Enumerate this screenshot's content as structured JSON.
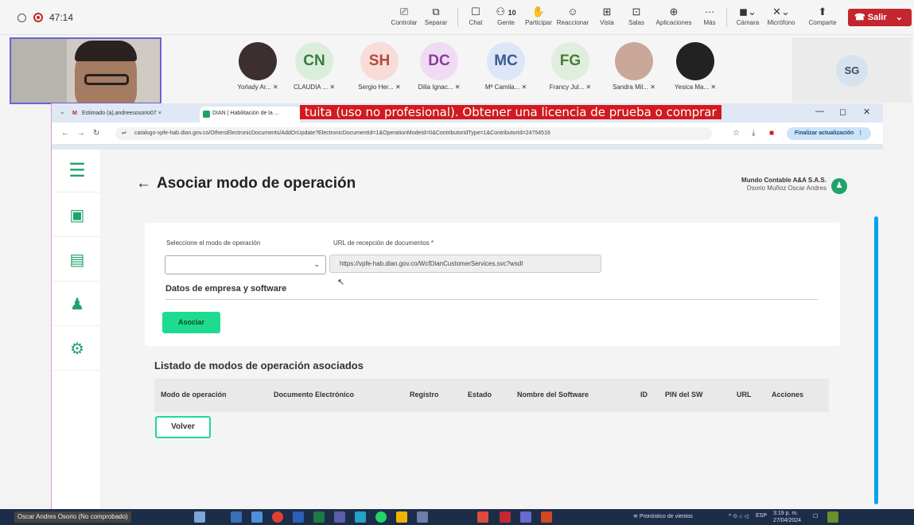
{
  "topbar": {
    "timer": "47:14",
    "buttons": [
      {
        "label": "Controlar",
        "icon": "control-icon"
      },
      {
        "label": "Separar",
        "icon": "popout-icon"
      },
      {
        "label": "Chat",
        "icon": "chat-icon"
      },
      {
        "label": "Gente",
        "icon": "people-icon",
        "count": "10"
      },
      {
        "label": "Participar",
        "icon": "raise-hand-icon"
      },
      {
        "label": "Reaccionar",
        "icon": "react-icon"
      },
      {
        "label": "Vista",
        "icon": "view-icon"
      },
      {
        "label": "Salas",
        "icon": "rooms-icon"
      },
      {
        "label": "Aplicaciones",
        "icon": "apps-icon"
      },
      {
        "label": "Más",
        "icon": "more-icon"
      },
      {
        "label": "Cámara",
        "icon": "camera-off-icon"
      },
      {
        "label": "Micrófono",
        "icon": "mic-off-icon"
      },
      {
        "label": "Comparte",
        "icon": "share-icon"
      }
    ],
    "leave_label": "Salir"
  },
  "participants": [
    {
      "initials": "",
      "name": "Yorlady Ar...",
      "bg": "#3b2f2f",
      "fg": "#ffffff"
    },
    {
      "initials": "CN",
      "name": "CLAUDIA ...",
      "bg": "#dbeedc",
      "fg": "#3a7c41"
    },
    {
      "initials": "SH",
      "name": "Sergio Her...",
      "bg": "#f7dcd8",
      "fg": "#b44a3c"
    },
    {
      "initials": "DC",
      "name": "Dilia Ignac...",
      "bg": "#efdcf3",
      "fg": "#8a3c9c"
    },
    {
      "initials": "MC",
      "name": "Mª Camila...",
      "bg": "#dde6f6",
      "fg": "#3c5a8f"
    },
    {
      "initials": "FG",
      "name": "Francy Jul...",
      "bg": "#e0eedd",
      "fg": "#4c7c3c"
    },
    {
      "initials": "",
      "name": "Sandra Mil...",
      "bg": "#c9a89a",
      "fg": "#ffffff"
    },
    {
      "initials": "",
      "name": "Yesica Ma...",
      "bg": "#222222",
      "fg": "#ffffff"
    }
  ],
  "sg_initials": "SG",
  "browser": {
    "tab1": "Estimado (a),andreesosorio07 ×",
    "tab2": "DIAN | Habilitación de la ...",
    "watermark": "tuita (uso no profesional). Obtener una licencia de prueba o comprar",
    "url": "catalogo-vpfe-hab.dian.gov.co/OthersElectronicDocuments/AddOrUpdate?ElectronicDocumentId=1&OperationModeId=0&ContributorIdType=1&ContributorId=24754516",
    "finish_update": "Finalizar actualización"
  },
  "page": {
    "title": "Asociar modo de operación",
    "company": "Mundo Contable A&A S.A.S.",
    "user": "Osorio Muñoz Oscar Andres",
    "select_label": "Seleccione el modo de operación",
    "select_value": "",
    "url_label": "URL de recepción de documentos *",
    "url_value": "https://vpfe-hab.dian.gov.co/WcfDianCustomerServices.svc?wsdl",
    "section_title": "Datos de empresa y software",
    "associate_button": "Asociar",
    "list_title": "Listado de modos de operación asociados",
    "columns": [
      "Modo de operación",
      "Documento Electrónico",
      "Registro",
      "Estado",
      "Nombre del Software",
      "ID",
      "PIN del SW",
      "URL",
      "Acciones"
    ],
    "back_button": "Volver"
  },
  "taskbar": {
    "presenter": "Oscar Andres Osorio (No comprobado)",
    "weather": "Pronóstico de vientos",
    "lang": "ESP",
    "time": "3:19 p. m.",
    "date": "27/04/2024"
  },
  "colors": {
    "accent": "#1edc8f",
    "leave": "#c4262e",
    "sidebar_icon": "#1fa36a",
    "watermark": "#d21a1f"
  }
}
